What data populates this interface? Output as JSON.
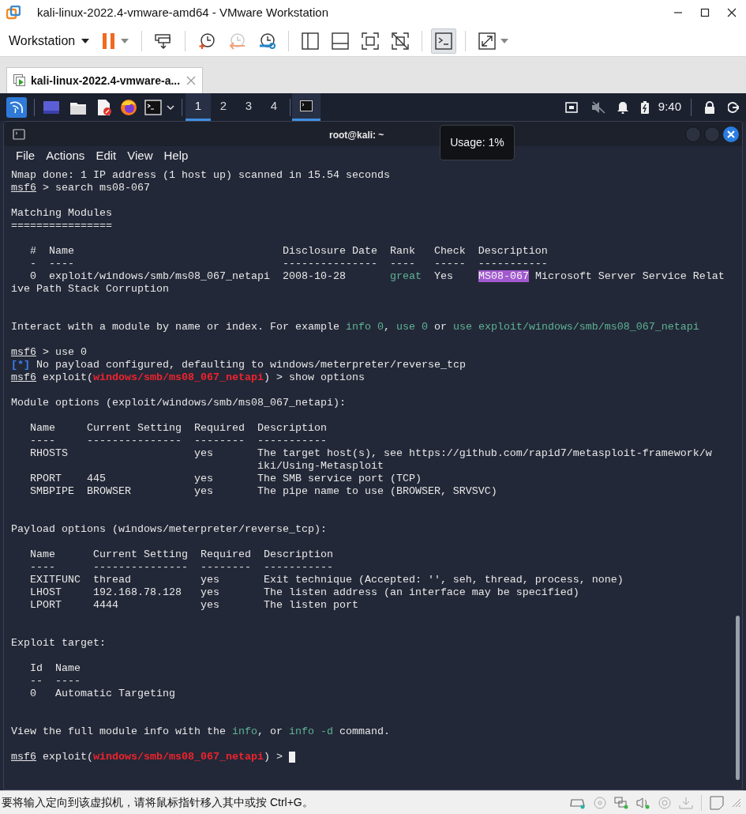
{
  "window": {
    "title": "kali-linux-2022.4-vmware-amd64 - VMware Workstation"
  },
  "toolbar": {
    "menu_label": "Workstation",
    "buttons": [
      {
        "kind": "pause",
        "selected": false
      },
      {
        "kind": "separator"
      },
      {
        "kind": "send-keys",
        "selected": false
      },
      {
        "kind": "separator"
      },
      {
        "kind": "snapshot",
        "selected": false
      },
      {
        "kind": "revert",
        "selected": false
      },
      {
        "kind": "manage-snapshots",
        "selected": false
      },
      {
        "kind": "separator"
      },
      {
        "kind": "sidebar",
        "selected": false
      },
      {
        "kind": "thumbnail",
        "selected": false
      },
      {
        "kind": "fullscreen",
        "selected": false
      },
      {
        "kind": "unity",
        "selected": false
      },
      {
        "kind": "separator"
      },
      {
        "kind": "console",
        "selected": true
      },
      {
        "kind": "separator"
      },
      {
        "kind": "stretch",
        "selected": false
      }
    ]
  },
  "tabs": [
    {
      "label": "kali-linux-2022.4-vmware-a...",
      "selected": true
    }
  ],
  "panel": {
    "workspaces": [
      {
        "label": "1",
        "selected": true
      },
      {
        "label": "2",
        "selected": false
      },
      {
        "label": "3",
        "selected": false
      },
      {
        "label": "4",
        "selected": false
      }
    ],
    "tasks": [
      {
        "kind": "terminal",
        "selected": true
      }
    ],
    "clock": "9:40"
  },
  "terminal": {
    "title": "root@kali: ~",
    "menu": [
      "File",
      "Actions",
      "Edit",
      "View",
      "Help"
    ],
    "lines": [
      {
        "kind": "text",
        "segments": [
          {
            "kind": "plain",
            "text": "Nmap done: 1 IP address (1 host up) scanned in 15.54 seconds"
          }
        ]
      },
      {
        "kind": "text",
        "segments": [
          {
            "kind": "prompt",
            "text": "msf6"
          },
          {
            "kind": "plain",
            "text": " > search ms08-067"
          }
        ]
      },
      {
        "kind": "blank"
      },
      {
        "kind": "text",
        "segments": [
          {
            "kind": "plain",
            "text": "Matching Modules"
          }
        ]
      },
      {
        "kind": "text",
        "segments": [
          {
            "kind": "plain",
            "text": "================"
          }
        ]
      },
      {
        "kind": "blank"
      },
      {
        "kind": "text",
        "segments": [
          {
            "kind": "plain",
            "text": "   #  Name                                 Disclosure Date  Rank   Check  Description"
          }
        ]
      },
      {
        "kind": "text",
        "segments": [
          {
            "kind": "plain",
            "text": "   -  ----                                 ---------------  ----   -----  -----------"
          }
        ]
      },
      {
        "kind": "text",
        "segments": [
          {
            "kind": "plain",
            "text": "   0  exploit/windows/smb/ms08_067_netapi  2008-10-28       "
          },
          {
            "kind": "green",
            "text": "great"
          },
          {
            "kind": "plain",
            "text": "  Yes    "
          },
          {
            "kind": "highlight",
            "text": "MS08-067"
          },
          {
            "kind": "plain",
            "text": " Microsoft Server Service Relat"
          }
        ]
      },
      {
        "kind": "text",
        "segments": [
          {
            "kind": "plain",
            "text": "ive Path Stack Corruption"
          }
        ]
      },
      {
        "kind": "blank"
      },
      {
        "kind": "blank"
      },
      {
        "kind": "text",
        "segments": [
          {
            "kind": "plain",
            "text": "Interact with a module by name or index. For example "
          },
          {
            "kind": "green",
            "text": "info 0"
          },
          {
            "kind": "plain",
            "text": ", "
          },
          {
            "kind": "green",
            "text": "use 0"
          },
          {
            "kind": "plain",
            "text": " or "
          },
          {
            "kind": "green",
            "text": "use exploit/windows/smb/ms08_067_netapi"
          }
        ]
      },
      {
        "kind": "blank"
      },
      {
        "kind": "text",
        "segments": [
          {
            "kind": "prompt",
            "text": "msf6"
          },
          {
            "kind": "plain",
            "text": " > use 0"
          }
        ]
      },
      {
        "kind": "text",
        "segments": [
          {
            "kind": "blue",
            "text": "[*]"
          },
          {
            "kind": "plain",
            "text": " No payload configured, defaulting to windows/meterpreter/reverse_tcp"
          }
        ]
      },
      {
        "kind": "text",
        "segments": [
          {
            "kind": "prompt",
            "text": "msf6"
          },
          {
            "kind": "plain",
            "text": " exploit("
          },
          {
            "kind": "red",
            "text": "windows/smb/ms08_067_netapi"
          },
          {
            "kind": "plain",
            "text": ") > show options"
          }
        ]
      },
      {
        "kind": "blank"
      },
      {
        "kind": "text",
        "segments": [
          {
            "kind": "plain",
            "text": "Module options (exploit/windows/smb/ms08_067_netapi):"
          }
        ]
      },
      {
        "kind": "blank"
      },
      {
        "kind": "text",
        "segments": [
          {
            "kind": "plain",
            "text": "   Name     Current Setting  Required  Description"
          }
        ]
      },
      {
        "kind": "text",
        "segments": [
          {
            "kind": "plain",
            "text": "   ----     ---------------  --------  -----------"
          }
        ]
      },
      {
        "kind": "text",
        "segments": [
          {
            "kind": "plain",
            "text": "   RHOSTS                    yes       The target host(s), see https://github.com/rapid7/metasploit-framework/w"
          }
        ]
      },
      {
        "kind": "text",
        "segments": [
          {
            "kind": "plain",
            "text": "                                       iki/Using-Metasploit"
          }
        ]
      },
      {
        "kind": "text",
        "segments": [
          {
            "kind": "plain",
            "text": "   RPORT    445              yes       The SMB service port (TCP)"
          }
        ]
      },
      {
        "kind": "text",
        "segments": [
          {
            "kind": "plain",
            "text": "   SMBPIPE  BROWSER          yes       The pipe name to use (BROWSER, SRVSVC)"
          }
        ]
      },
      {
        "kind": "blank"
      },
      {
        "kind": "blank"
      },
      {
        "kind": "text",
        "segments": [
          {
            "kind": "plain",
            "text": "Payload options (windows/meterpreter/reverse_tcp):"
          }
        ]
      },
      {
        "kind": "blank"
      },
      {
        "kind": "text",
        "segments": [
          {
            "kind": "plain",
            "text": "   Name      Current Setting  Required  Description"
          }
        ]
      },
      {
        "kind": "text",
        "segments": [
          {
            "kind": "plain",
            "text": "   ----      ---------------  --------  -----------"
          }
        ]
      },
      {
        "kind": "text",
        "segments": [
          {
            "kind": "plain",
            "text": "   EXITFUNC  thread           yes       Exit technique (Accepted: '', seh, thread, process, none)"
          }
        ]
      },
      {
        "kind": "text",
        "segments": [
          {
            "kind": "plain",
            "text": "   LHOST     192.168.78.128   yes       The listen address (an interface may be specified)"
          }
        ]
      },
      {
        "kind": "text",
        "segments": [
          {
            "kind": "plain",
            "text": "   LPORT     4444             yes       The listen port"
          }
        ]
      },
      {
        "kind": "blank"
      },
      {
        "kind": "blank"
      },
      {
        "kind": "text",
        "segments": [
          {
            "kind": "plain",
            "text": "Exploit target:"
          }
        ]
      },
      {
        "kind": "blank"
      },
      {
        "kind": "text",
        "segments": [
          {
            "kind": "plain",
            "text": "   Id  Name"
          }
        ]
      },
      {
        "kind": "text",
        "segments": [
          {
            "kind": "plain",
            "text": "   --  ----"
          }
        ]
      },
      {
        "kind": "text",
        "segments": [
          {
            "kind": "plain",
            "text": "   0   Automatic Targeting"
          }
        ]
      },
      {
        "kind": "blank"
      },
      {
        "kind": "blank"
      },
      {
        "kind": "text",
        "segments": [
          {
            "kind": "plain",
            "text": "View the full module info with the "
          },
          {
            "kind": "green",
            "text": "info"
          },
          {
            "kind": "plain",
            "text": ", or "
          },
          {
            "kind": "green",
            "text": "info -d"
          },
          {
            "kind": "plain",
            "text": " command."
          }
        ]
      },
      {
        "kind": "blank"
      },
      {
        "kind": "text",
        "cursor": true,
        "segments": [
          {
            "kind": "prompt",
            "text": "msf6"
          },
          {
            "kind": "plain",
            "text": " exploit("
          },
          {
            "kind": "red",
            "text": "windows/smb/ms08_067_netapi"
          },
          {
            "kind": "plain",
            "text": ") > "
          }
        ]
      }
    ]
  },
  "tooltip": {
    "text": "Usage: 1%"
  },
  "status_bar": {
    "message": "要将输入定向到该虚拟机，请将鼠标指针移入其中或按 Ctrl+G。"
  }
}
